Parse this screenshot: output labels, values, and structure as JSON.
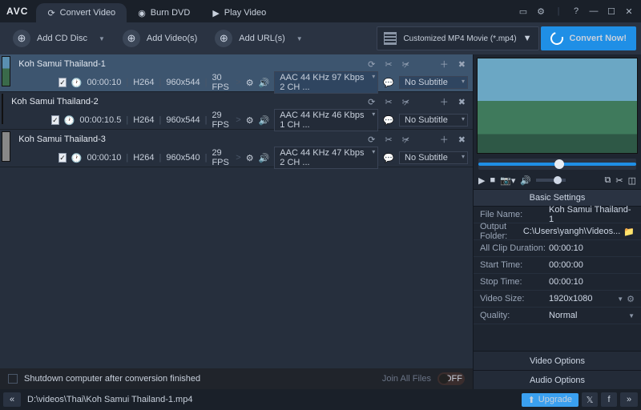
{
  "app": {
    "logo": "AVC"
  },
  "tabs": [
    {
      "label": "Convert Video"
    },
    {
      "label": "Burn DVD"
    },
    {
      "label": "Play Video"
    }
  ],
  "toolbar": {
    "addDisc": "Add CD Disc",
    "addVideos": "Add Video(s)",
    "addUrls": "Add URL(s)",
    "profile": "Customized MP4 Movie (*.mp4)",
    "convert": "Convert Now!"
  },
  "items": [
    {
      "title": "Koh Samui Thailand-1",
      "dur": "00:00:10",
      "vcodec": "H264",
      "res": "960x544",
      "fps": "30 FPS",
      "audio": "AAC 44 KHz 97 Kbps 2 CH ...",
      "sub": "No Subtitle"
    },
    {
      "title": "Koh Samui Thailand-2",
      "dur": "00:00:10.5",
      "vcodec": "H264",
      "res": "960x544",
      "fps": "29 FPS",
      "audio": "AAC 44 KHz 46 Kbps 1 CH ...",
      "sub": "No Subtitle"
    },
    {
      "title": "Koh Samui Thailand-3",
      "dur": "00:00:10",
      "vcodec": "H264",
      "res": "960x540",
      "fps": "29 FPS",
      "audio": "AAC 44 KHz 47 Kbps 2 CH ...",
      "sub": "No Subtitle"
    }
  ],
  "footer": {
    "shutdown": "Shutdown computer after conversion finished",
    "join": "Join All Files",
    "toggle": "OFF",
    "path": "D:\\videos\\Thai\\Koh Samui Thailand-1.mp4",
    "upgrade": "Upgrade"
  },
  "settings": {
    "header": "Basic Settings",
    "rows": {
      "filename": {
        "k": "File Name:",
        "v": "Koh Samui Thailand-1"
      },
      "output": {
        "k": "Output Folder:",
        "v": "C:\\Users\\yangh\\Videos..."
      },
      "clipdur": {
        "k": "All Clip Duration:",
        "v": "00:00:10"
      },
      "start": {
        "k": "Start Time:",
        "v": "00:00:00"
      },
      "stop": {
        "k": "Stop Time:",
        "v": "00:00:10"
      },
      "vsize": {
        "k": "Video Size:",
        "v": "1920x1080"
      },
      "quality": {
        "k": "Quality:",
        "v": "Normal"
      }
    },
    "videoOpt": "Video Options",
    "audioOpt": "Audio Options"
  }
}
